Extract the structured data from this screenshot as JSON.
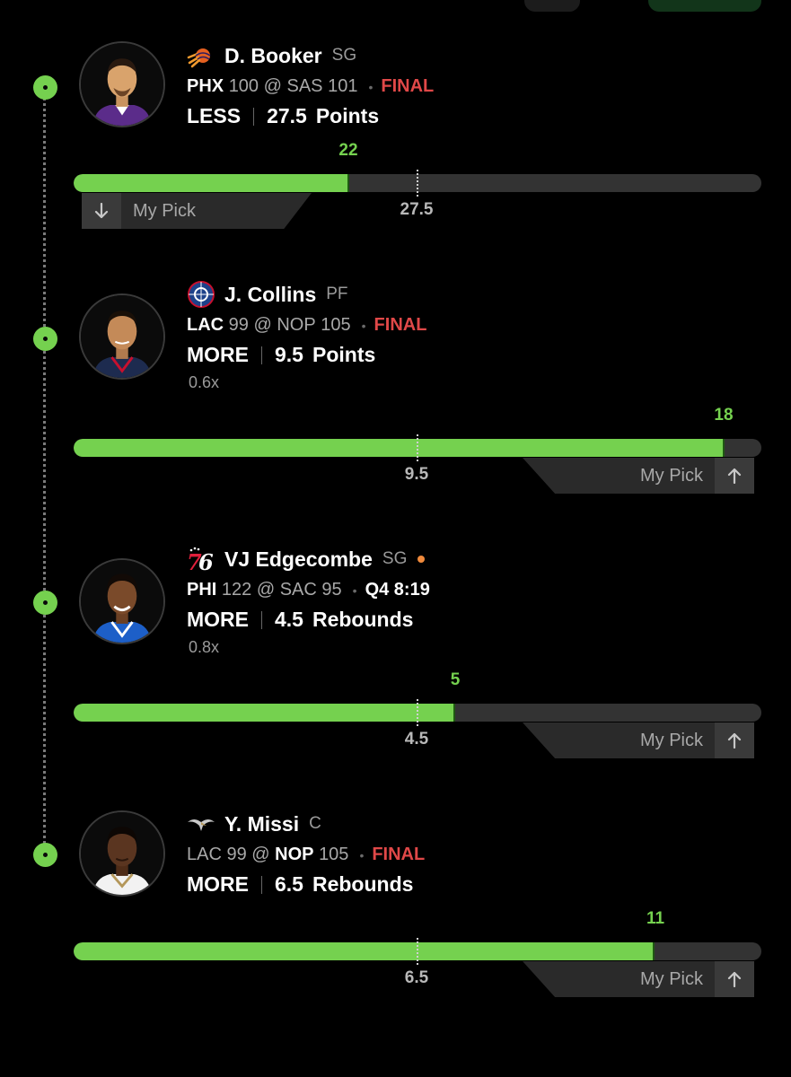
{
  "accent_color": "#75d14f",
  "final_color": "#e04848",
  "picks": [
    {
      "name": "D. Booker",
      "position": "SG",
      "team_logo_icon": "suns-logo-icon",
      "away": "PHX",
      "away_score": "100",
      "at": "@",
      "home": "SAS",
      "home_score": "101",
      "bold_team": "away",
      "status": "FINAL",
      "status_type": "final",
      "direction": "LESS",
      "line": "27.5",
      "stat": "Points",
      "multiplier": "",
      "actual": "22",
      "actual_value": 22,
      "line_value": 27.5,
      "my_pick_label": "My Pick",
      "pick_arrow": "down"
    },
    {
      "name": "J. Collins",
      "position": "PF",
      "team_logo_icon": "clippers-logo-icon",
      "away": "LAC",
      "away_score": "99",
      "at": "@",
      "home": "NOP",
      "home_score": "105",
      "bold_team": "away",
      "status": "FINAL",
      "status_type": "final",
      "direction": "MORE",
      "line": "9.5",
      "stat": "Points",
      "multiplier": "0.6x",
      "actual": "18",
      "actual_value": 18,
      "line_value": 9.5,
      "my_pick_label": "My Pick",
      "pick_arrow": "up"
    },
    {
      "name": "VJ Edgecombe",
      "position": "SG",
      "team_logo_icon": "76ers-logo-icon",
      "away": "PHI",
      "away_score": "122",
      "at": "@",
      "home": "SAC",
      "home_score": "95",
      "bold_team": "away",
      "status": "Q4 8:19",
      "status_type": "live",
      "direction": "MORE",
      "line": "4.5",
      "stat": "Rebounds",
      "multiplier": "0.8x",
      "actual": "5",
      "actual_value": 5,
      "line_value": 4.5,
      "my_pick_label": "My Pick",
      "pick_arrow": "up"
    },
    {
      "name": "Y. Missi",
      "position": "C",
      "team_logo_icon": "pelicans-logo-icon",
      "away": "LAC",
      "away_score": "99",
      "at": "@",
      "home": "NOP",
      "home_score": "105",
      "bold_team": "home",
      "status": "FINAL",
      "status_type": "final",
      "direction": "MORE",
      "line": "6.5",
      "stat": "Rebounds",
      "multiplier": "",
      "actual": "11",
      "actual_value": 11,
      "line_value": 6.5,
      "my_pick_label": "My Pick",
      "pick_arrow": "up"
    }
  ]
}
